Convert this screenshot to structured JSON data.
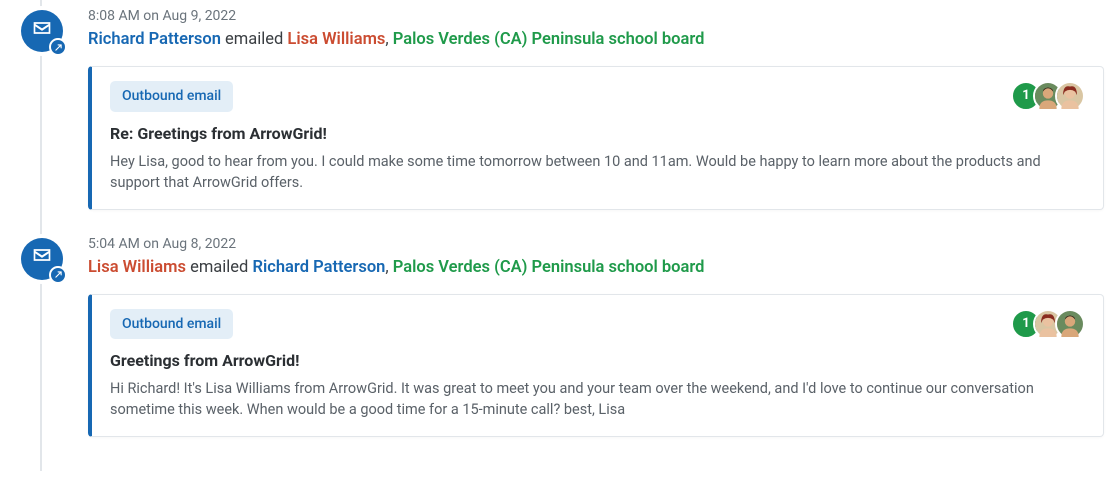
{
  "entries": [
    {
      "timestamp": "8:08 AM on Aug 9, 2022",
      "summary": {
        "actor": {
          "name": "Richard Patterson",
          "cls": "link-blue"
        },
        "verb": "emailed",
        "recipients": [
          {
            "name": "Lisa Williams",
            "cls": "link-red"
          },
          {
            "name": "Palos Verdes (CA) Peninsula school board",
            "cls": "link-green"
          }
        ]
      },
      "card": {
        "tag": "Outbound email",
        "subject": "Re: Greetings from ArrowGrid!",
        "body": "Hey Lisa, good to hear from you. I could make some time tomorrow between 10 and 11am. Would be happy to learn more about the products and support that ArrowGrid offers.",
        "avatars": {
          "count": "1",
          "people": [
            {
              "bg": "#6a8b5e",
              "hair": "#3e2b1e",
              "face": "#d9a77a"
            },
            {
              "bg": "#d9c6a3",
              "hair": "#8a2c1f",
              "face": "#eac2a0"
            }
          ]
        }
      }
    },
    {
      "timestamp": "5:04 AM on Aug 8, 2022",
      "summary": {
        "actor": {
          "name": "Lisa Williams",
          "cls": "link-red"
        },
        "verb": "emailed",
        "recipients": [
          {
            "name": "Richard Patterson",
            "cls": "link-blue"
          },
          {
            "name": "Palos Verdes (CA) Peninsula school board",
            "cls": "link-green"
          }
        ]
      },
      "card": {
        "tag": "Outbound email",
        "subject": "Greetings from ArrowGrid!",
        "body": "Hi Richard! It's Lisa Williams from ArrowGrid. It was great to meet you and your team over the weekend, and I'd love to continue our conversation sometime this week. When would be a good time for a 15-minute call? best, Lisa",
        "avatars": {
          "count": "1",
          "people": [
            {
              "bg": "#d9c6a3",
              "hair": "#8a2c1f",
              "face": "#eac2a0"
            },
            {
              "bg": "#6a8b5e",
              "hair": "#3e2b1e",
              "face": "#d9a77a"
            }
          ]
        }
      }
    }
  ]
}
